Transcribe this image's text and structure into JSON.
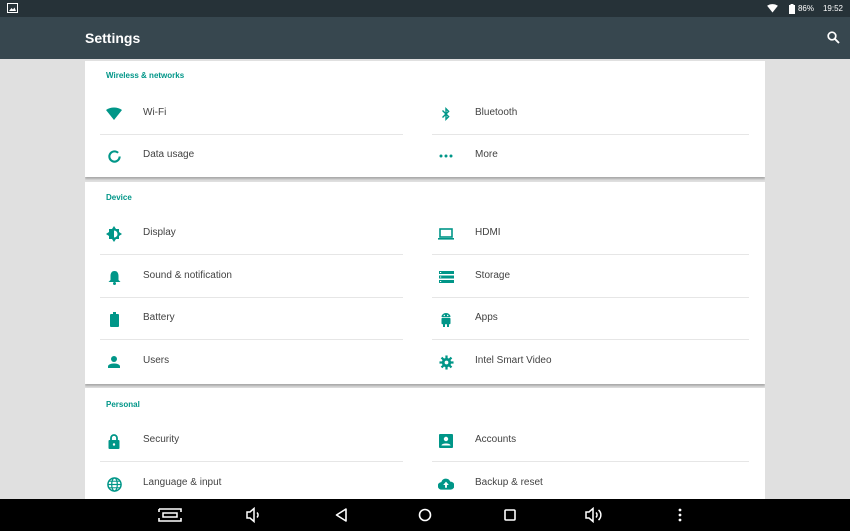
{
  "status_bar": {
    "battery": "86%",
    "time": "19:52",
    "icons": [
      "image-notification-icon",
      "wifi-signal-icon",
      "battery-icon"
    ]
  },
  "app_bar": {
    "title": "Settings",
    "search_icon": "search-icon"
  },
  "sections": [
    {
      "header": "Wireless & networks",
      "items": [
        {
          "label": "Wi-Fi",
          "icon": "wifi-icon"
        },
        {
          "label": "Bluetooth",
          "icon": "bluetooth-icon"
        },
        {
          "label": "Data usage",
          "icon": "data-usage-icon"
        },
        {
          "label": "More",
          "icon": "more-dots-icon"
        }
      ]
    },
    {
      "header": "Device",
      "items": [
        {
          "label": "Display",
          "icon": "brightness-icon"
        },
        {
          "label": "HDMI",
          "icon": "laptop-icon"
        },
        {
          "label": "Sound & notification",
          "icon": "bell-icon"
        },
        {
          "label": "Storage",
          "icon": "storage-icon"
        },
        {
          "label": "Battery",
          "icon": "battery-icon"
        },
        {
          "label": "Apps",
          "icon": "android-icon"
        },
        {
          "label": "Users",
          "icon": "person-icon"
        },
        {
          "label": "Intel Smart Video",
          "icon": "gear-icon"
        }
      ]
    },
    {
      "header": "Personal",
      "items": [
        {
          "label": "Security",
          "icon": "lock-icon"
        },
        {
          "label": "Accounts",
          "icon": "account-box-icon"
        },
        {
          "label": "Language & input",
          "icon": "globe-icon"
        },
        {
          "label": "Backup & reset",
          "icon": "cloud-upload-icon"
        }
      ]
    }
  ],
  "nav_bar": {
    "buttons": [
      "screenshot-icon",
      "volume-down-icon",
      "back-icon",
      "home-icon",
      "recents-icon",
      "volume-up-icon",
      "overflow-menu-icon"
    ]
  },
  "colors": {
    "accent": "#009688",
    "status_bar": "#263238",
    "app_bar": "#37474f",
    "background": "#e0e0e0"
  }
}
